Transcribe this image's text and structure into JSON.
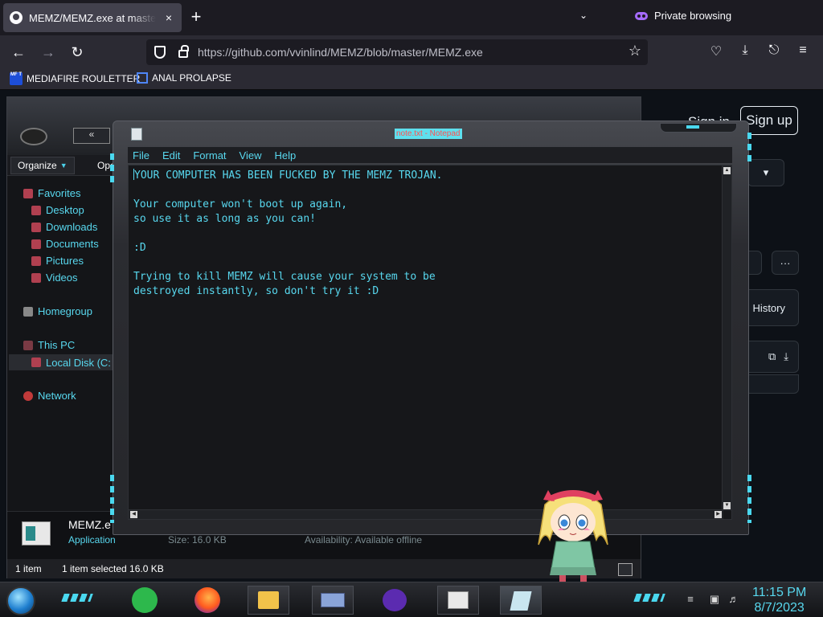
{
  "browser": {
    "tab_title": "MEMZ/MEMZ.exe at master · vvinlind/MEMZ",
    "tab_close": "×",
    "new_tab": "+",
    "private_label": "Private browsing",
    "url_host": "https://github.com",
    "url_path": "/vvinlind/MEMZ/blob/master/MEMZ.exe",
    "bookmarks": [
      {
        "label": "MEDIAFIRE ROULETTER",
        "icon_text": "MF T"
      },
      {
        "label": "ANAL PROLAPSE"
      }
    ]
  },
  "github": {
    "sign_in": "Sign in",
    "sign_up": "Sign up",
    "history_label": "History",
    "more_label": "···"
  },
  "explorer": {
    "back_label": "«",
    "organize_label": "Organize",
    "open_label": "Ope",
    "nav_items": [
      {
        "label": "Favorites",
        "kind": "fav"
      },
      {
        "label": "Desktop",
        "kind": "sub"
      },
      {
        "label": "Downloads",
        "kind": "sub"
      },
      {
        "label": "Documents",
        "kind": "sub"
      },
      {
        "label": "Pictures",
        "kind": "sub"
      },
      {
        "label": "Videos",
        "kind": "sub"
      },
      {
        "label": "Homegroup",
        "kind": "home"
      },
      {
        "label": "This PC",
        "kind": "pc"
      },
      {
        "label": "Local Disk (C:",
        "kind": "disk"
      },
      {
        "label": "Network",
        "kind": "net"
      }
    ],
    "file_name": "MEMZ.e",
    "file_type": "Application",
    "size_text": "Size: 16.0 KB",
    "availability_text": "Availability: Available offline",
    "status_items": "1 item",
    "status_selected": "1 item selected  16.0 KB"
  },
  "notepad": {
    "title": "note.txt - Notepad",
    "menu": [
      "File",
      "Edit",
      "Format",
      "View",
      "Help"
    ],
    "lines": [
      "YOUR COMPUTER HAS BEEN FUCKED BY THE MEMZ TROJAN.",
      "",
      "Your computer won't boot up again,",
      "so use it as long as you can!",
      "",
      ":D",
      "",
      "Trying to kill MEMZ will cause your system to be",
      "destroyed instantly, so don't try it :D"
    ]
  },
  "taskbar": {
    "time": "11:15 PM",
    "date": "8/7/2023",
    "apps": [
      "spotify-like-icon",
      "firefox-icon",
      "file-explorer-icon",
      "control-panel-icon",
      "private-browsing-icon",
      "memz-app-icon",
      "notepad-icon"
    ]
  },
  "colors": {
    "accent_cyan": "#58d8ef",
    "firefox_bg": "#1c1b22",
    "private_purple": "#a56bff"
  }
}
